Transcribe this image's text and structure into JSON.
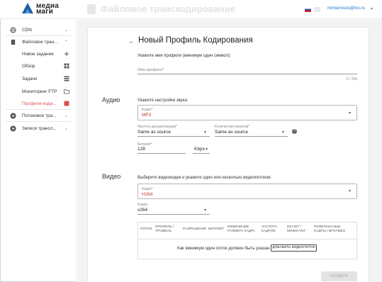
{
  "header": {
    "logo_line1": "медиа",
    "logo_line2": "маги",
    "app_title": "Файловое транскодирование",
    "user_email": "mmservices@tvc.ru",
    "user_caret": "▾",
    "flags": [
      "ru-flag",
      "us-flag"
    ]
  },
  "sidebar": {
    "items": [
      {
        "label": "CDN",
        "icon": "globe-icon",
        "chevron": "⌄"
      },
      {
        "label": "Файловое тран...",
        "icon": "file-icon",
        "chevron": "⌃"
      },
      {
        "label": "Новое задание",
        "icon": "plus-icon"
      },
      {
        "label": "Обзор",
        "icon": "grid-icon"
      },
      {
        "label": "Задачи",
        "icon": "list-icon"
      },
      {
        "label": "Мониторинг FTP",
        "icon": "folder-icon"
      },
      {
        "label": "Профили коди...",
        "icon": "profile-icon"
      },
      {
        "label": "Потоковое тра...",
        "icon": "play-circle-icon",
        "chevron": "⌄"
      },
      {
        "label": "Записи трансл...",
        "icon": "play-circle-icon",
        "chevron": "⌄"
      }
    ]
  },
  "form": {
    "back_arrow": "←",
    "title": "Новый Профиль Кодирования",
    "name_hint": "Укажите имя профиля (минимум один символ):",
    "name_label": "Имя профиля*",
    "name_counter": "0 / 255",
    "audio": {
      "section": "Аудио",
      "hint": "Укажите настройки звука:",
      "codec_label": "Кодек*",
      "codec_value": "MP3",
      "samplerate_label": "Частота дискретизации*",
      "samplerate_value": "Same as source",
      "channels_label": "Количество каналов*",
      "channels_value": "Same as source",
      "help_glyph": "?",
      "bitrate_label": "Битрейт*",
      "bitrate_value": "128",
      "bitrate_unit": "Kbps"
    },
    "video": {
      "section": "Видео",
      "hint": "Выберите видеокодек и укажите один или несколько видеопотоков:",
      "codec_label": "Кодек*",
      "codec_value": "H264",
      "encoder_label": "Кодер",
      "encoder_value": "x264",
      "table_headers": [
        "ПОТОК",
        "ПРОФИЛЬ / УРОВЕНЬ",
        "РАЗРЕШЕНИЕ",
        "БИТРЕЙТ",
        "ИЗМЕНЕНИЕ РАЗМЕРА КАДРА",
        "ЧАСТОТА КАДРОВ",
        "KEYINT / MINKEYINT",
        "РЕФЕРЕНСНЫЕ КАДРЫ / BFRAMES"
      ],
      "empty_message": "Как минимум один поток должен быть указан",
      "add_stream_label": "ДОБАВИТЬ ВИДЕОПОТОК"
    },
    "create_label": "СОЗДАТЬ"
  },
  "colors": {
    "accent": "#1a73c9",
    "active_item": "#d9534f",
    "logo_blue": "#1e5fa8"
  }
}
